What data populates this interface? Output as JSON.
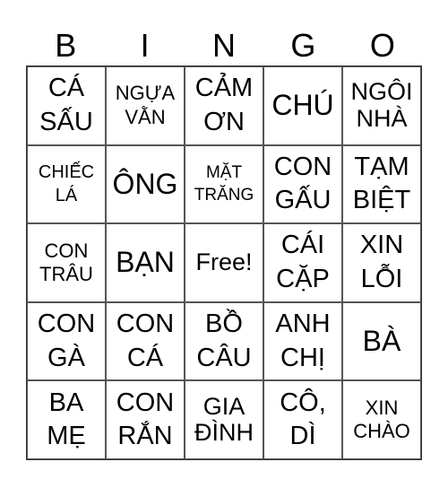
{
  "title_letters": [
    "B",
    "I",
    "N",
    "G",
    "O"
  ],
  "cells": [
    [
      "CÁ SẤU",
      "NGỰA VẰN",
      "CẢM ƠN",
      "CHÚ",
      "NGÔI NHÀ"
    ],
    [
      "CHIẾC LÁ",
      "ÔNG",
      "MẶT TRĂNG",
      "CON GẤU",
      "TẠM BIỆT"
    ],
    [
      "CON TRÂU",
      "BẠN",
      "Free!",
      "CÁI CẶP",
      "XIN LỖI"
    ],
    [
      "CON GÀ",
      "CON CÁ",
      "BỒ CÂU",
      "ANH CHỊ",
      "BÀ"
    ],
    [
      "BA MẸ",
      "CON RẮN",
      "GIA ĐÌNH",
      "CÔ, DÌ",
      "XIN CHÀO"
    ]
  ]
}
